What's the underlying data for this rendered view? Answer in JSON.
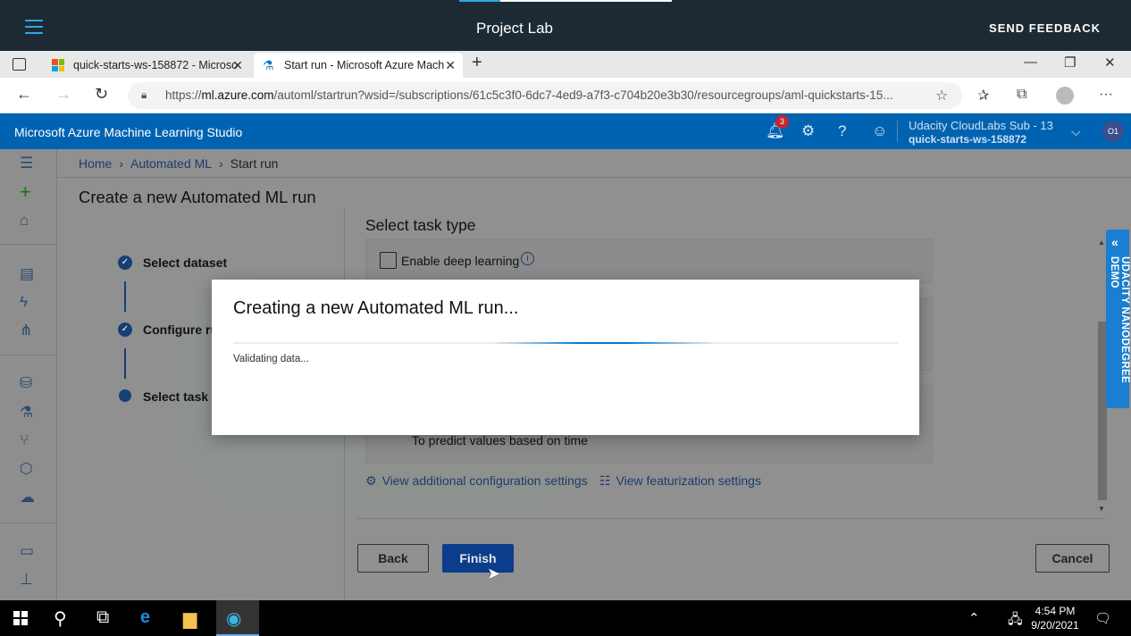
{
  "lab": {
    "title": "Project Lab",
    "feedback": "SEND FEEDBACK"
  },
  "browser": {
    "tabs": [
      {
        "label": "quick-starts-ws-158872 - Microso"
      },
      {
        "label": "Start run - Microsoft Azure Mach"
      }
    ],
    "url_scheme": "https://",
    "url_host": "ml.azure.com",
    "url_rest": "/automl/startrun?wsid=/subscriptions/61c5c3f0-6dc7-4ed9-a7f3-c704b20e3b30/resourcegroups/aml-quickstarts-15..."
  },
  "azure": {
    "brand": "Microsoft Azure Machine Learning Studio",
    "notification_count": "3",
    "subscription": "Udacity CloudLabs Sub - 13",
    "workspace": "quick-starts-ws-158872",
    "user_initials": "O1"
  },
  "breadcrumb": {
    "home": "Home",
    "automl": "Automated ML",
    "current": "Start run"
  },
  "page": {
    "title": "Create a new Automated ML run",
    "steps": [
      "Select dataset",
      "Configure ru",
      "Select task a"
    ],
    "task_type_heading": "Select task type",
    "deep_learning_label": "Enable deep learning",
    "forecast_desc": "To predict values based on time",
    "link_config": "View additional configuration settings",
    "link_featurization": "View featurization settings",
    "back_label": "Back",
    "finish_label": "Finish",
    "cancel_label": "Cancel"
  },
  "udacity_panel": {
    "label": "UDACITY NANODEGREE DEMO"
  },
  "modal": {
    "title": "Creating a new Automated ML run...",
    "status": "Validating data..."
  },
  "taskbar": {
    "time": "4:54 PM",
    "date": "9/20/2021"
  }
}
